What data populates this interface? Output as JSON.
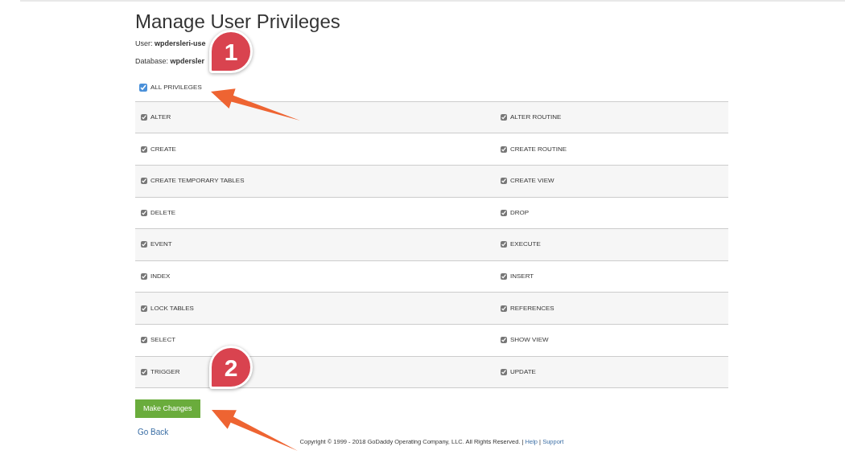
{
  "title": "Manage User Privileges",
  "user": {
    "label": "User:",
    "value": "wpdersleri-use"
  },
  "database": {
    "label": "Database:",
    "value": "wpdersler"
  },
  "all_privileges": {
    "label": "ALL PRIVILEGES",
    "checked": true
  },
  "privileges": [
    {
      "label": "ALTER",
      "checked": true
    },
    {
      "label": "ALTER ROUTINE",
      "checked": true
    },
    {
      "label": "CREATE",
      "checked": true
    },
    {
      "label": "CREATE ROUTINE",
      "checked": true
    },
    {
      "label": "CREATE TEMPORARY TABLES",
      "checked": true
    },
    {
      "label": "CREATE VIEW",
      "checked": true
    },
    {
      "label": "DELETE",
      "checked": true
    },
    {
      "label": "DROP",
      "checked": true
    },
    {
      "label": "EVENT",
      "checked": true
    },
    {
      "label": "EXECUTE",
      "checked": true
    },
    {
      "label": "INDEX",
      "checked": true
    },
    {
      "label": "INSERT",
      "checked": true
    },
    {
      "label": "LOCK TABLES",
      "checked": true
    },
    {
      "label": "REFERENCES",
      "checked": true
    },
    {
      "label": "SELECT",
      "checked": true
    },
    {
      "label": "SHOW VIEW",
      "checked": true
    },
    {
      "label": "TRIGGER",
      "checked": true
    },
    {
      "label": "UPDATE",
      "checked": true
    }
  ],
  "submit_button": "Make Changes",
  "back_link": "Go Back",
  "footer": {
    "text": "Copyright © 1999 - 2018 GoDaddy Operating Company, LLC. All Rights Reserved. |",
    "links": [
      "Help",
      "Support"
    ],
    "separator": "|"
  },
  "annotations": [
    {
      "number": "1"
    },
    {
      "number": "2"
    }
  ]
}
